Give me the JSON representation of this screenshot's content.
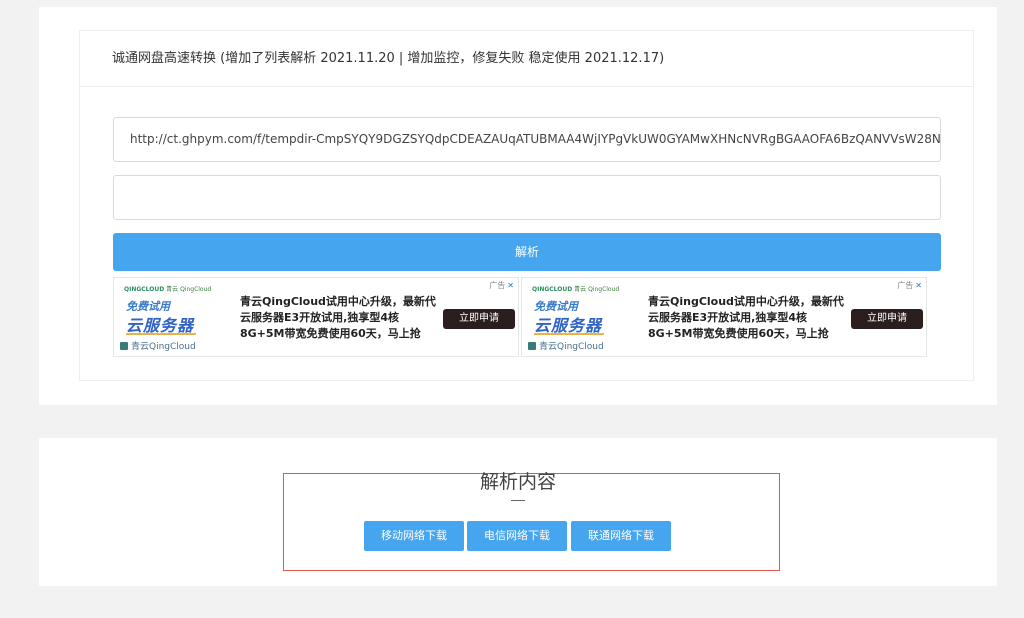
{
  "header": {
    "title": "诚通网盘高速转换 (增加了列表解析 2021.11.20 | 增加监控，修复失败 稳定使用 2021.12.17)"
  },
  "form": {
    "url_value": "http://ct.ghpym.com/f/tempdir-CmpSYQY9DGZSYQdpCDEAZAUqATUBMAA4WjIYPgVkUW0GYAMwXHNcNVRgBGAAOFA6BzQANVVsW28N",
    "second_value": "",
    "parse_button": "解析"
  },
  "ads": [
    {
      "brand": "QINGCLOUD",
      "brand_tag": "青云 QingCloud",
      "free_trial": "免费试用",
      "server": "云服务器",
      "logo_text": "青云QingCloud",
      "text": "青云QingCloud试用中心升级，最新代云服务器E3开放试用,独享型4核8G+5M带宽免费使用60天，马上抢",
      "cta": "立即申请",
      "label": "广告",
      "close": "✕"
    },
    {
      "brand": "QINGCLOUD",
      "brand_tag": "青云 QingCloud",
      "free_trial": "免费试用",
      "server": "云服务器",
      "logo_text": "青云QingCloud",
      "text": "青云QingCloud试用中心升级，最新代云服务器E3开放试用,独享型4核8G+5M带宽免费使用60天，马上抢",
      "cta": "立即申请",
      "label": "广告",
      "close": "✕"
    }
  ],
  "result": {
    "title": "解析内容",
    "buttons": [
      "移动网络下载",
      "电信网络下载",
      "联通网络下载"
    ]
  },
  "colors": {
    "primary": "#46a5ef",
    "highlight_border": "#e8554f",
    "cta_dark": "#2a1e1e"
  }
}
